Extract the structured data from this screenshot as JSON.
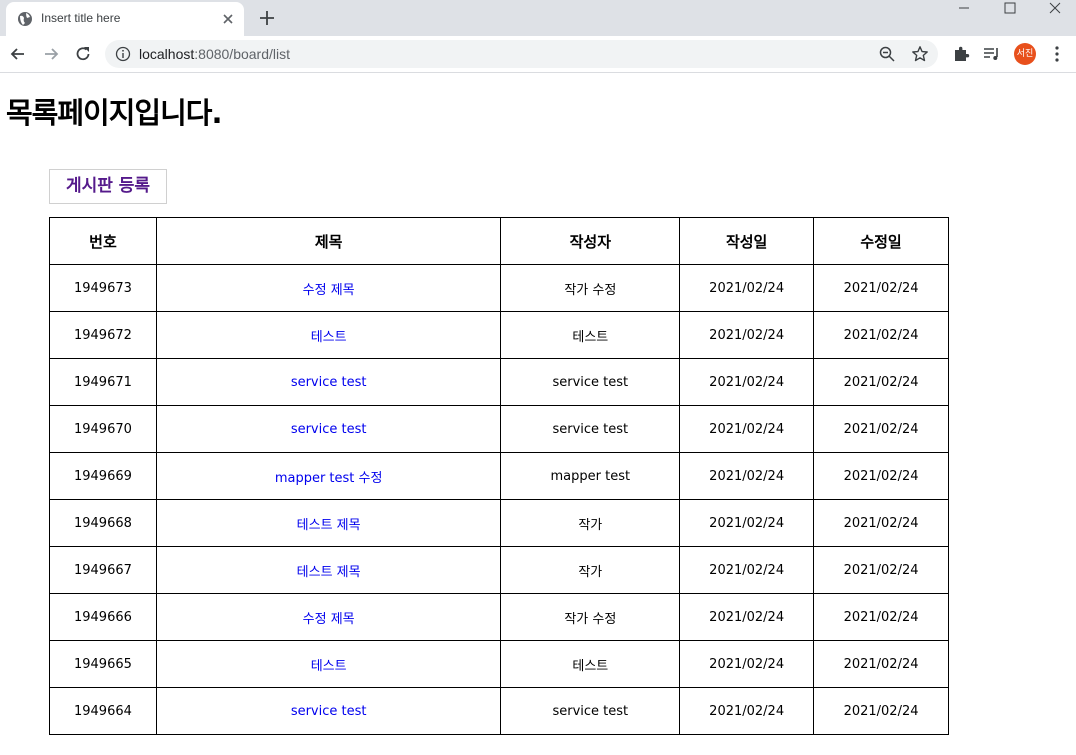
{
  "browser": {
    "tab_title": "Insert title here",
    "url_host": "localhost",
    "url_path": ":8080/board/list",
    "profile_initials": "서진",
    "profile_color": "#e8501c"
  },
  "page": {
    "title": "목록페이지입니다.",
    "register_label": "게시판 등록"
  },
  "table": {
    "headers": [
      "번호",
      "제목",
      "작성자",
      "작성일",
      "수정일"
    ],
    "rows": [
      {
        "no": "1949673",
        "title": "수정 제목",
        "writer": "작가 수정",
        "regdate": "2021/02/24",
        "updatedate": "2021/02/24"
      },
      {
        "no": "1949672",
        "title": "테스트",
        "writer": "테스트",
        "regdate": "2021/02/24",
        "updatedate": "2021/02/24"
      },
      {
        "no": "1949671",
        "title": "service test",
        "writer": "service test",
        "regdate": "2021/02/24",
        "updatedate": "2021/02/24"
      },
      {
        "no": "1949670",
        "title": "service test",
        "writer": "service test",
        "regdate": "2021/02/24",
        "updatedate": "2021/02/24"
      },
      {
        "no": "1949669",
        "title": "mapper test 수정",
        "writer": "mapper test",
        "regdate": "2021/02/24",
        "updatedate": "2021/02/24"
      },
      {
        "no": "1949668",
        "title": "테스트 제목",
        "writer": "작가",
        "regdate": "2021/02/24",
        "updatedate": "2021/02/24"
      },
      {
        "no": "1949667",
        "title": "테스트 제목",
        "writer": "작가",
        "regdate": "2021/02/24",
        "updatedate": "2021/02/24"
      },
      {
        "no": "1949666",
        "title": "수정 제목",
        "writer": "작가 수정",
        "regdate": "2021/02/24",
        "updatedate": "2021/02/24"
      },
      {
        "no": "1949665",
        "title": "테스트",
        "writer": "테스트",
        "regdate": "2021/02/24",
        "updatedate": "2021/02/24"
      },
      {
        "no": "1949664",
        "title": "service test",
        "writer": "service test",
        "regdate": "2021/02/24",
        "updatedate": "2021/02/24"
      }
    ]
  },
  "icons": {
    "favicon": "globe-icon",
    "tab_close": "close-icon",
    "new_tab": "plus-icon",
    "back": "arrow-left-icon",
    "forward": "arrow-right-icon",
    "reload": "reload-icon",
    "site_info": "info-icon",
    "zoom": "zoom-out-icon",
    "bookmark": "star-icon",
    "extensions": "puzzle-icon",
    "media": "media-control-icon",
    "menu": "kebab-menu-icon"
  },
  "colors": {
    "link": "#0000ee",
    "visited_link": "#551a8b",
    "tabstrip": "#dee1e6",
    "omnibox": "#f1f3f4"
  }
}
